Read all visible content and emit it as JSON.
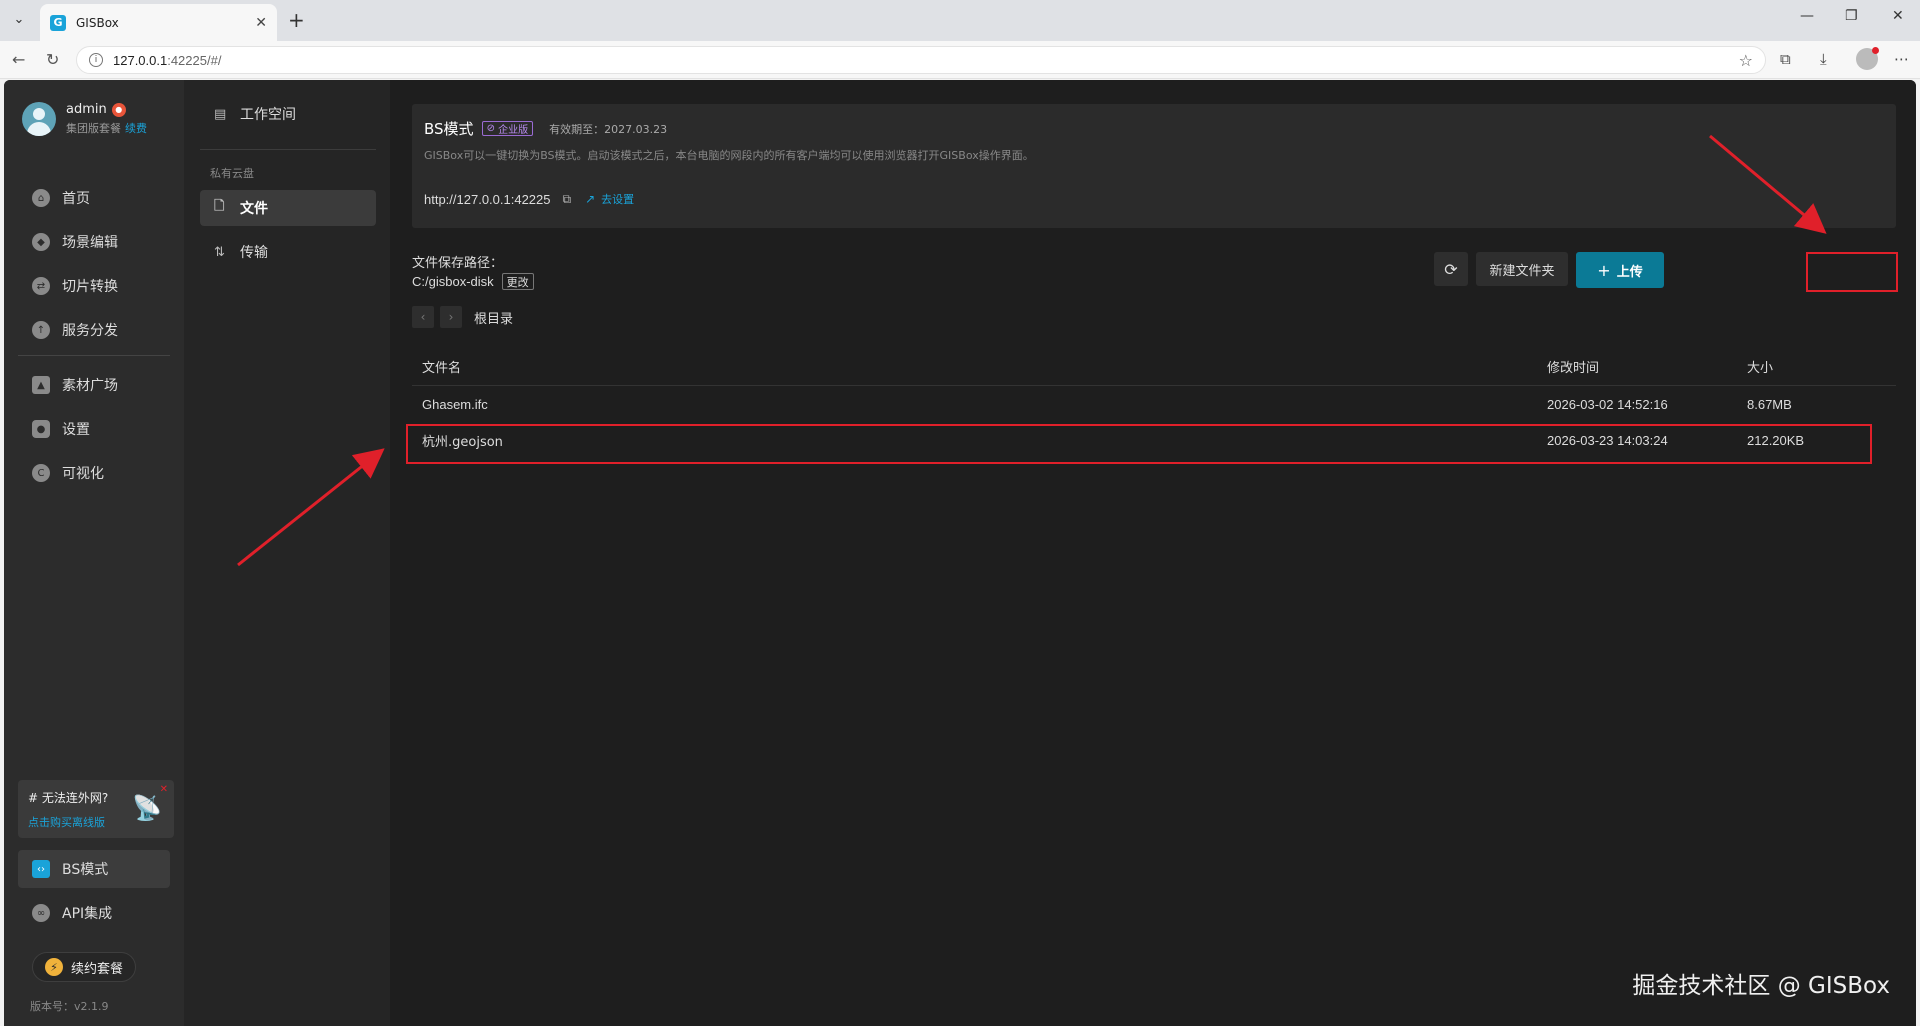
{
  "browser": {
    "tab_title": "GISBox",
    "tab_icon": "G",
    "url_host": "127.0.0.1",
    "url_rest": ":42225/#/"
  },
  "user": {
    "name": "admin",
    "plan": "集团版套餐",
    "renew_link": "续费"
  },
  "nav": {
    "items": [
      {
        "label": "首页",
        "icon": "home-icon"
      },
      {
        "label": "场景编辑",
        "icon": "cube-icon"
      },
      {
        "label": "切片转换",
        "icon": "swap-icon"
      },
      {
        "label": "服务分发",
        "icon": "upload-cloud-icon"
      },
      {
        "label": "素材广场",
        "icon": "image-icon"
      },
      {
        "label": "设置",
        "icon": "gear-icon"
      },
      {
        "label": "可视化",
        "icon": "chart-icon"
      }
    ],
    "bottom_items": [
      {
        "label": "BS模式",
        "icon": "code-icon"
      },
      {
        "label": "API集成",
        "icon": "link-icon"
      }
    ]
  },
  "promo": {
    "title": "# 无法连外网?",
    "link": "点击购买离线版"
  },
  "renew_button": "续约套餐",
  "version": "版本号：v2.1.9",
  "subnav": {
    "workspace": "工作空间",
    "section_label": "私有云盘",
    "files": "文件",
    "transfer": "传输"
  },
  "bs_card": {
    "title": "BS模式",
    "badge": "企业版",
    "expiry": "有效期至：2027.03.23",
    "description": "GISBox可以一键切换为BS模式。启动该模式之后，本台电脑的网段内的所有客户端均可以使用浏览器打开GISBox操作界面。",
    "url": "http://127.0.0.1:42225",
    "goto_settings": "去设置"
  },
  "storage": {
    "label": "文件保存路径：",
    "path": "C:/gisbox-disk",
    "change": "更改"
  },
  "breadcrumb": {
    "root": "根目录"
  },
  "toolbar": {
    "new_folder": "新建文件夹",
    "upload": "上传"
  },
  "table": {
    "columns": [
      "文件名",
      "修改时间",
      "大小"
    ],
    "rows": [
      {
        "name": "Ghasem.ifc",
        "modified": "2026-03-02 14:52:16",
        "size": "8.67MB"
      },
      {
        "name": "杭州.geojson",
        "modified": "2026-03-23 14:03:24",
        "size": "212.20KB"
      }
    ]
  },
  "watermark": "掘金技术社区 @ GISBox",
  "colors": {
    "accent": "#1aa3d9",
    "upload_button": "#0b7a96",
    "annotation": "#e0202a"
  }
}
